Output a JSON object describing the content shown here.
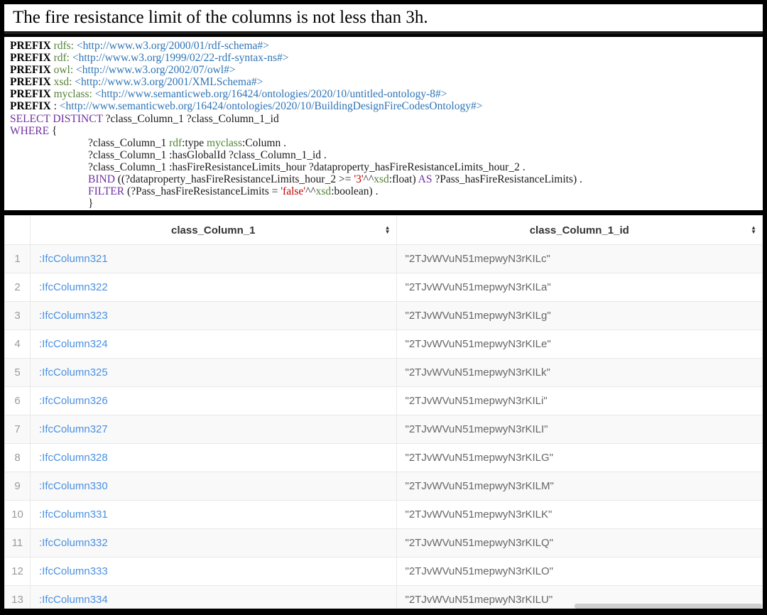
{
  "title": "The fire resistance limit of the columns is not less than 3h.",
  "colors": {
    "prefix_green": "#538135",
    "uri_blue": "#2e74b5",
    "sparql_purple": "#7030a0",
    "literal_red": "#c00000",
    "link_blue": "#4a90e2"
  },
  "query": {
    "lines": [
      {
        "indent": false,
        "tokens": [
          [
            "kw",
            "PREFIX "
          ],
          [
            "g",
            "rdfs:"
          ],
          [
            "t",
            " "
          ],
          [
            "u",
            "<http://www.w3.org/2000/01/rdf-schema#>"
          ]
        ]
      },
      {
        "indent": false,
        "tokens": [
          [
            "kw",
            "PREFIX "
          ],
          [
            "g",
            "rdf:"
          ],
          [
            "t",
            " "
          ],
          [
            "u",
            "<http://www.w3.org/1999/02/22-rdf-syntax-ns#>"
          ]
        ]
      },
      {
        "indent": false,
        "tokens": [
          [
            "kw",
            "PREFIX "
          ],
          [
            "g",
            "owl:"
          ],
          [
            "t",
            " "
          ],
          [
            "u",
            "<http://www.w3.org/2002/07/owl#>"
          ]
        ]
      },
      {
        "indent": false,
        "tokens": [
          [
            "kw",
            "PREFIX "
          ],
          [
            "g",
            "xsd:"
          ],
          [
            "t",
            " "
          ],
          [
            "u",
            "<http://www.w3.org/2001/XMLSchema#>"
          ]
        ]
      },
      {
        "indent": false,
        "tokens": [
          [
            "kw",
            "PREFIX "
          ],
          [
            "g",
            "myclass:"
          ],
          [
            "t",
            " "
          ],
          [
            "u",
            "<http://www.semanticweb.org/16424/ontologies/2020/10/untitled-ontology-8#>"
          ]
        ]
      },
      {
        "indent": false,
        "tokens": [
          [
            "kw",
            "PREFIX "
          ],
          [
            "t",
            ": "
          ],
          [
            "u",
            "<http://www.semanticweb.org/16424/ontologies/2020/10/BuildingDesignFireCodesOntology#>"
          ]
        ]
      },
      {
        "indent": false,
        "tokens": [
          [
            "sp",
            "SELECT DISTINCT "
          ],
          [
            "t",
            "?class_Column_1 ?class_Column_1_id"
          ]
        ]
      },
      {
        "indent": false,
        "tokens": [
          [
            "sp",
            "WHERE "
          ],
          [
            "t",
            "{"
          ]
        ]
      },
      {
        "indent": true,
        "tokens": [
          [
            "t",
            "?class_Column_1 "
          ],
          [
            "g",
            "rdf"
          ],
          [
            "t",
            ":type "
          ],
          [
            "g",
            "myclass"
          ],
          [
            "t",
            ":Column ."
          ]
        ]
      },
      {
        "indent": true,
        "tokens": [
          [
            "t",
            "?class_Column_1 :hasGlobalId ?class_Column_1_id ."
          ]
        ]
      },
      {
        "indent": true,
        "tokens": [
          [
            "t",
            "?class_Column_1 :hasFireResistanceLimits_hour ?dataproperty_hasFireResistanceLimits_hour_2 ."
          ]
        ]
      },
      {
        "indent": true,
        "tokens": [
          [
            "sp",
            "BIND"
          ],
          [
            "t",
            " ((?dataproperty_hasFireResistanceLimits_hour_2 >= "
          ],
          [
            "lit",
            "'3'"
          ],
          [
            "t",
            "^^"
          ],
          [
            "g",
            "xsd"
          ],
          [
            "t",
            ":float) "
          ],
          [
            "sp",
            "AS"
          ],
          [
            "t",
            " ?Pass_hasFireResistanceLimits) ."
          ]
        ]
      },
      {
        "indent": true,
        "tokens": [
          [
            "sp",
            "FILTER"
          ],
          [
            "t",
            " (?Pass_hasFireResistanceLimits = "
          ],
          [
            "lit",
            "'false'"
          ],
          [
            "t",
            "^^"
          ],
          [
            "g",
            "xsd"
          ],
          [
            "t",
            ":boolean) ."
          ]
        ]
      },
      {
        "indent": true,
        "tokens": [
          [
            "t",
            "}"
          ]
        ]
      }
    ]
  },
  "table": {
    "sort_up": "▲",
    "sort_down": "▼",
    "columns": [
      {
        "label": "class_Column_1"
      },
      {
        "label": "class_Column_1_id"
      }
    ],
    "rows": [
      {
        "num": "1",
        "col1": ":IfcColumn321",
        "col2": "\"2TJvWVuN51mepwyN3rKILc\""
      },
      {
        "num": "2",
        "col1": ":IfcColumn322",
        "col2": "\"2TJvWVuN51mepwyN3rKILa\""
      },
      {
        "num": "3",
        "col1": ":IfcColumn323",
        "col2": "\"2TJvWVuN51mepwyN3rKILg\""
      },
      {
        "num": "4",
        "col1": ":IfcColumn324",
        "col2": "\"2TJvWVuN51mepwyN3rKILe\""
      },
      {
        "num": "5",
        "col1": ":IfcColumn325",
        "col2": "\"2TJvWVuN51mepwyN3rKILk\""
      },
      {
        "num": "6",
        "col1": ":IfcColumn326",
        "col2": "\"2TJvWVuN51mepwyN3rKILi\""
      },
      {
        "num": "7",
        "col1": ":IfcColumn327",
        "col2": "\"2TJvWVuN51mepwyN3rKILI\""
      },
      {
        "num": "8",
        "col1": ":IfcColumn328",
        "col2": "\"2TJvWVuN51mepwyN3rKILG\""
      },
      {
        "num": "9",
        "col1": ":IfcColumn330",
        "col2": "\"2TJvWVuN51mepwyN3rKILM\""
      },
      {
        "num": "10",
        "col1": ":IfcColumn331",
        "col2": "\"2TJvWVuN51mepwyN3rKILK\""
      },
      {
        "num": "11",
        "col1": ":IfcColumn332",
        "col2": "\"2TJvWVuN51mepwyN3rKILQ\""
      },
      {
        "num": "12",
        "col1": ":IfcColumn333",
        "col2": "\"2TJvWVuN51mepwyN3rKILO\""
      },
      {
        "num": "13",
        "col1": ":IfcColumn334",
        "col2": "\"2TJvWVuN51mepwyN3rKILU\""
      }
    ]
  }
}
